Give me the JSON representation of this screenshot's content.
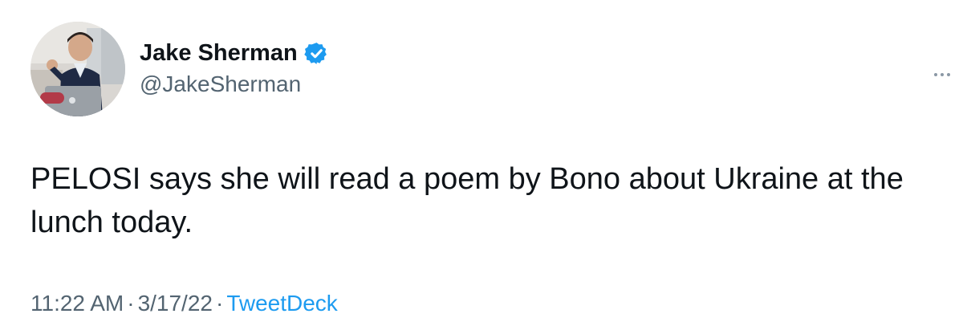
{
  "author": {
    "display_name": "Jake Sherman",
    "handle": "@JakeSherman",
    "verified": true
  },
  "tweet": {
    "text": "PELOSI says she will read a poem by Bono about Ukraine at the lunch today.",
    "time": "11:22 AM",
    "separator": "·",
    "date": "3/17/22",
    "source": "TweetDeck"
  },
  "icons": {
    "verified": "verified-badge-icon",
    "more": "more-dots-icon"
  },
  "colors": {
    "text": "#0f1419",
    "secondary": "#536471",
    "link": "#1d9bf0",
    "verified": "#1d9bf0"
  }
}
